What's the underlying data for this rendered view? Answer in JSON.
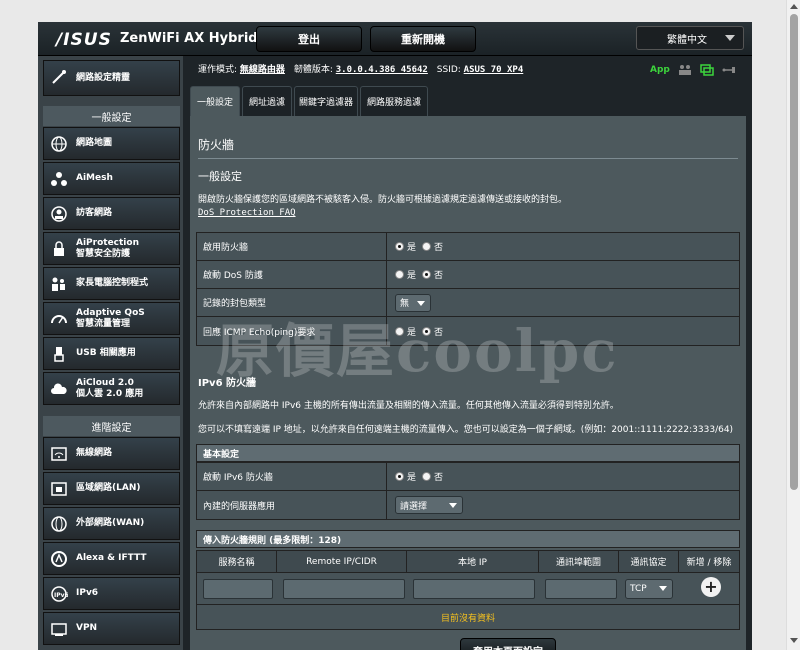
{
  "header": {
    "brand": "/ISUS",
    "model": "ZenWiFi AX Hybrid",
    "logout_label": "登出",
    "reboot_label": "重新開機",
    "language": "繁體中文"
  },
  "sidebar": {
    "quick_setup": "網路設定精靈",
    "general_heading": "一般設定",
    "general_items": [
      {
        "line1": "網路地圖",
        "line2": ""
      },
      {
        "line1": "AiMesh",
        "line2": ""
      },
      {
        "line1": "訪客網路",
        "line2": ""
      },
      {
        "line1": "AiProtection",
        "line2": "智慧安全防護"
      },
      {
        "line1": "家長電腦控制程式",
        "line2": ""
      },
      {
        "line1": "Adaptive QoS",
        "line2": "智慧流量管理"
      },
      {
        "line1": "USB 相關應用",
        "line2": ""
      },
      {
        "line1": "AiCloud 2.0",
        "line2": "個人雲 2.0 應用"
      }
    ],
    "advanced_heading": "進階設定",
    "advanced_items": [
      {
        "line1": "無線網路"
      },
      {
        "line1": "區域網路(LAN)"
      },
      {
        "line1": "外部網路(WAN)"
      },
      {
        "line1": "Alexa & IFTTT"
      },
      {
        "line1": "IPv6"
      },
      {
        "line1": "VPN"
      }
    ]
  },
  "status": {
    "mode_label": "運作模式:",
    "mode_value": "無線路由器",
    "fw_label": "韌體版本:",
    "fw_value": "3.0.0.4.386_45642",
    "ssid_label": "SSID:",
    "ssid_value": "ASUS_70_XP4",
    "app_label": "App"
  },
  "tabs": [
    {
      "label": "一般設定"
    },
    {
      "label": "網址過濾"
    },
    {
      "label": "關鍵字過濾器"
    },
    {
      "label": "網路服務過濾"
    }
  ],
  "panel": {
    "title": "防火牆",
    "section_general": "一般設定",
    "description": "開啟防火牆保護您的區域網路不被駭客入侵。防火牆可根據過濾規定過濾傳送或接收的封包。",
    "dos_link": "DoS Protection FAQ",
    "rows": [
      {
        "label": "啟用防火牆",
        "yes": "是",
        "no": "否",
        "selected": "yes"
      },
      {
        "label": "啟動 DoS 防護",
        "yes": "是",
        "no": "否",
        "selected": "no"
      },
      {
        "label": "記錄的封包類型",
        "select_value": "無"
      },
      {
        "label": "回應 ICMP Echo(ping)要求",
        "yes": "是",
        "no": "否",
        "selected": "no"
      }
    ],
    "ipv6_title": "IPv6 防火牆",
    "ipv6_desc1": "允許來自內部網路中 IPv6 主機的所有傳出流量及相關的傳入流量。任何其他傳入流量必須得到特別允許。",
    "ipv6_desc2": "您可以不填寫遠端 IP 地址，以允許來自任何遠端主機的流量傳入。您也可以設定為一個子網域。(例如：2001::1111:2222:3333/64)",
    "basic_heading": "基本設定",
    "basic_rows": [
      {
        "label": "啟動 IPv6 防火牆",
        "yes": "是",
        "no": "否",
        "selected": "yes"
      },
      {
        "label": "內建的伺服器應用",
        "select_value": "請選擇"
      }
    ],
    "rules_heading": "傳入防火牆規則 (最多限制：128)",
    "rules_columns": [
      "服務名稱",
      "Remote IP/CIDR",
      "本地 IP",
      "通訊埠範圍",
      "通訊協定",
      "新增 / 移除"
    ],
    "protocol_value": "TCP",
    "no_data": "目前沒有資料",
    "apply_label": "套用本頁面設定"
  },
  "watermark": "原價屋coolpc",
  "colors": {
    "panel_bg": "#4d595d",
    "sidebar_bg": "#3a4348",
    "no_data_text": "#f6c11e",
    "app_green": "#3cd43c"
  }
}
